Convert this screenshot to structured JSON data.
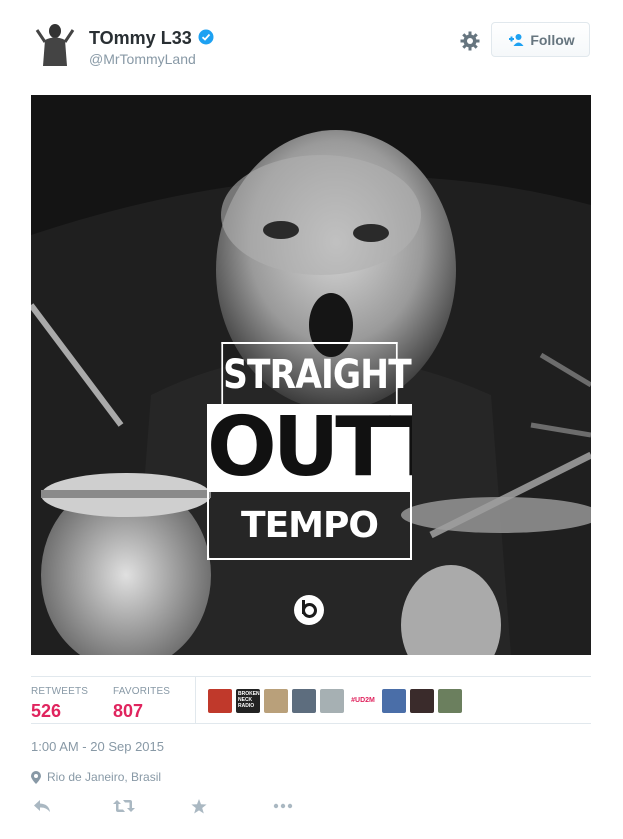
{
  "user": {
    "fullname": "TOmmy L33",
    "username": "@MrTommyLand",
    "verified": true
  },
  "header_actions": {
    "follow_label": "Follow",
    "settings_icon": "gear-icon"
  },
  "media": {
    "poster": {
      "line1": "STRAIGHT",
      "line2": "OUTTA",
      "line3": "TEMPO"
    },
    "logo": "beats-logo"
  },
  "stats": {
    "retweets_label": "RETWEETS",
    "retweets_value": "526",
    "favorites_label": "FAVORITES",
    "favorites_value": "807",
    "favoriters": [
      {
        "type": "image",
        "color": "#c0392b"
      },
      {
        "type": "text",
        "text": "BROKEN NECK RADIO"
      },
      {
        "type": "image",
        "color": "#b9a07a"
      },
      {
        "type": "image",
        "color": "#5d6d7e"
      },
      {
        "type": "image",
        "color": "#a6b0b3"
      },
      {
        "type": "tag",
        "text": "#UD2M"
      },
      {
        "type": "image",
        "color": "#4a6ea8"
      },
      {
        "type": "image",
        "color": "#3a2b2b"
      },
      {
        "type": "image",
        "color": "#6b7f5e"
      }
    ]
  },
  "timestamp": "1:00 AM - 20 Sep 2015",
  "location": "Rio de Janeiro, Brasil",
  "actions": [
    "reply-icon",
    "retweet-icon",
    "favorite-icon",
    "more-icon"
  ],
  "colors": {
    "accent_red": "#e0245e",
    "muted": "#8899a6",
    "verified_blue": "#1da1f2"
  }
}
